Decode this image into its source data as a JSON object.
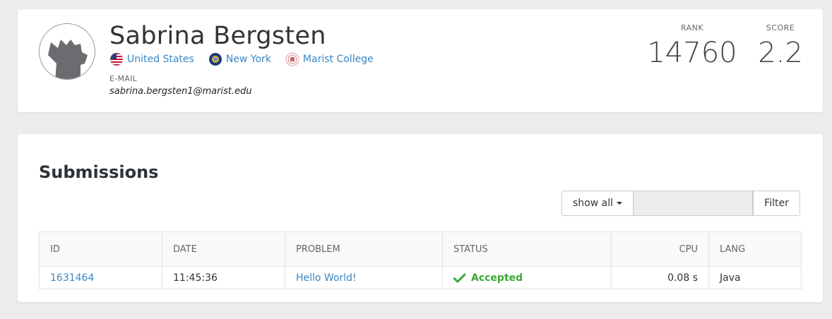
{
  "profile": {
    "name": "Sabrina Bergsten",
    "country": "United States",
    "state": "New York",
    "school": "Marist College",
    "email_label": "E-MAIL",
    "email": "sabrina.bergsten1@marist.edu",
    "rank_label": "RANK",
    "rank": "14760",
    "score_label": "SCORE",
    "score": "2.2"
  },
  "submissions": {
    "title": "Submissions",
    "filter_dropdown_label": "show all",
    "filter_input_value": "",
    "filter_button_label": "Filter",
    "columns": {
      "id": "ID",
      "date": "DATE",
      "problem": "PROBLEM",
      "status": "STATUS",
      "cpu": "CPU",
      "lang": "LANG"
    },
    "rows": [
      {
        "id": "1631464",
        "date": "11:45:36",
        "problem": "Hello World!",
        "status": "Accepted",
        "cpu": "0.08 s",
        "lang": "Java"
      }
    ]
  },
  "colors": {
    "link": "#3b86c4",
    "accepted": "#3aa835",
    "background": "#ececec"
  },
  "icons": {
    "avatar": "default-avatar-icon",
    "country": "us-flag-icon",
    "state": "new-york-seal-icon",
    "school": "college-logo-icon",
    "status": "checkmark-icon"
  }
}
